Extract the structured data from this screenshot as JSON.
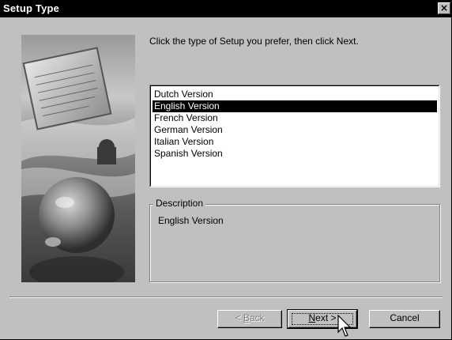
{
  "window": {
    "title": "Setup Type",
    "close_symbol": "×"
  },
  "prompt": "Click the type of Setup you prefer, then click Next.",
  "versions": {
    "items": [
      "Dutch Version",
      "English Version",
      "French Version",
      "German Version",
      "Italian Version",
      "Spanish Version"
    ],
    "selected": "English Version"
  },
  "description": {
    "label": "Description",
    "text": "English Version"
  },
  "buttons": {
    "back": {
      "label": "Back",
      "prefix": "< ",
      "mnemonic": "B",
      "enabled": false
    },
    "next": {
      "label": "Next",
      "suffix": " >",
      "mnemonic": "N",
      "default": true
    },
    "cancel": {
      "label": "Cancel"
    }
  },
  "colors": {
    "titlebar": "#000000",
    "face": "#c0c0c0",
    "selection": "#000000"
  },
  "icons": {
    "close": "close-icon",
    "cursor": "arrow-cursor-icon",
    "picture": "setup-artwork"
  }
}
